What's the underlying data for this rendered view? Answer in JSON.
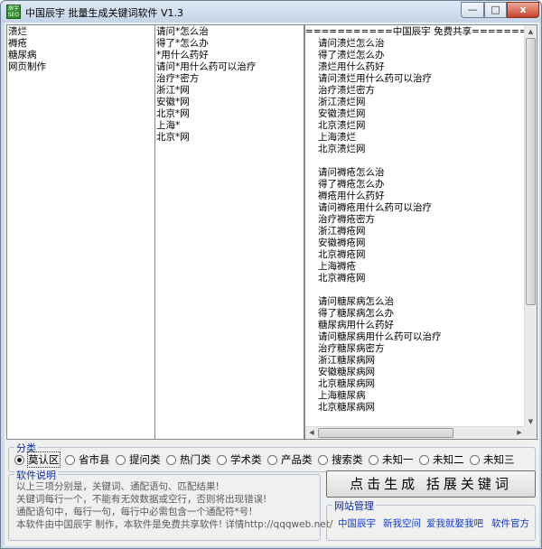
{
  "window": {
    "title": "中国辰宇 批量生成关键词软件 V1.3",
    "icon_text": "辰宇 SEO",
    "controls": {
      "minimize": "—",
      "maximize": "□",
      "close": "x"
    }
  },
  "keywords": [
    "溃烂",
    "褥疮",
    "糖尿病",
    "网页制作"
  ],
  "templates": [
    "请问*怎么治",
    "得了*怎么办",
    "*用什么药好",
    "请问*用什么药可以治疗",
    "治疗*密方",
    "浙江*网",
    "安徽*网",
    "北京*网",
    "上海*",
    "北京*网"
  ],
  "results": [
    "===========中国辰宇 免费共享================",
    "请问溃烂怎么治",
    "得了溃烂怎么办",
    "溃烂用什么药好",
    "请问溃烂用什么药可以治疗",
    "治疗溃烂密方",
    "浙江溃烂网",
    "安徽溃烂网",
    "北京溃烂网",
    "上海溃烂",
    "北京溃烂网",
    "",
    "请问褥疮怎么治",
    "得了褥疮怎么办",
    "褥疮用什么药好",
    "请问褥疮用什么药可以治疗",
    "治疗褥疮密方",
    "浙江褥疮网",
    "安徽褥疮网",
    "北京褥疮网",
    "上海褥疮",
    "北京褥疮网",
    "",
    "请问糖尿病怎么治",
    "得了糖尿病怎么办",
    "糖尿病用什么药好",
    "请问糖尿病用什么药可以治疗",
    "治疗糖尿病密方",
    "浙江糖尿病网",
    "安徽糖尿病网",
    "北京糖尿病网",
    "上海糖尿病",
    "北京糖尿病网"
  ],
  "category": {
    "legend": "分类",
    "options": [
      "莫认区",
      "省市县",
      "提问类",
      "热门类",
      "学术类",
      "产品类",
      "搜索类",
      "未知一",
      "未知二",
      "未知三"
    ],
    "selected_index": 0
  },
  "help": {
    "legend": "软件说明",
    "lines": [
      "以上三项分别是，关键词、通配语句、匹配结果!",
      "关键词每行一个，不能有无效数据或空行，否则将出现错误!",
      "通配语句中，每行一句，每行中必需包含一个通配符*号!",
      "本软件由中国辰宇 制作，本软件是免费共享软件! 详情http://qqqweb.net/"
    ]
  },
  "generate_button": "点击生成 括展关键词",
  "site": {
    "legend": "网站管理",
    "links": [
      "中国辰宇",
      "新我空间",
      "爱我就娶我吧",
      "软件官方"
    ]
  }
}
